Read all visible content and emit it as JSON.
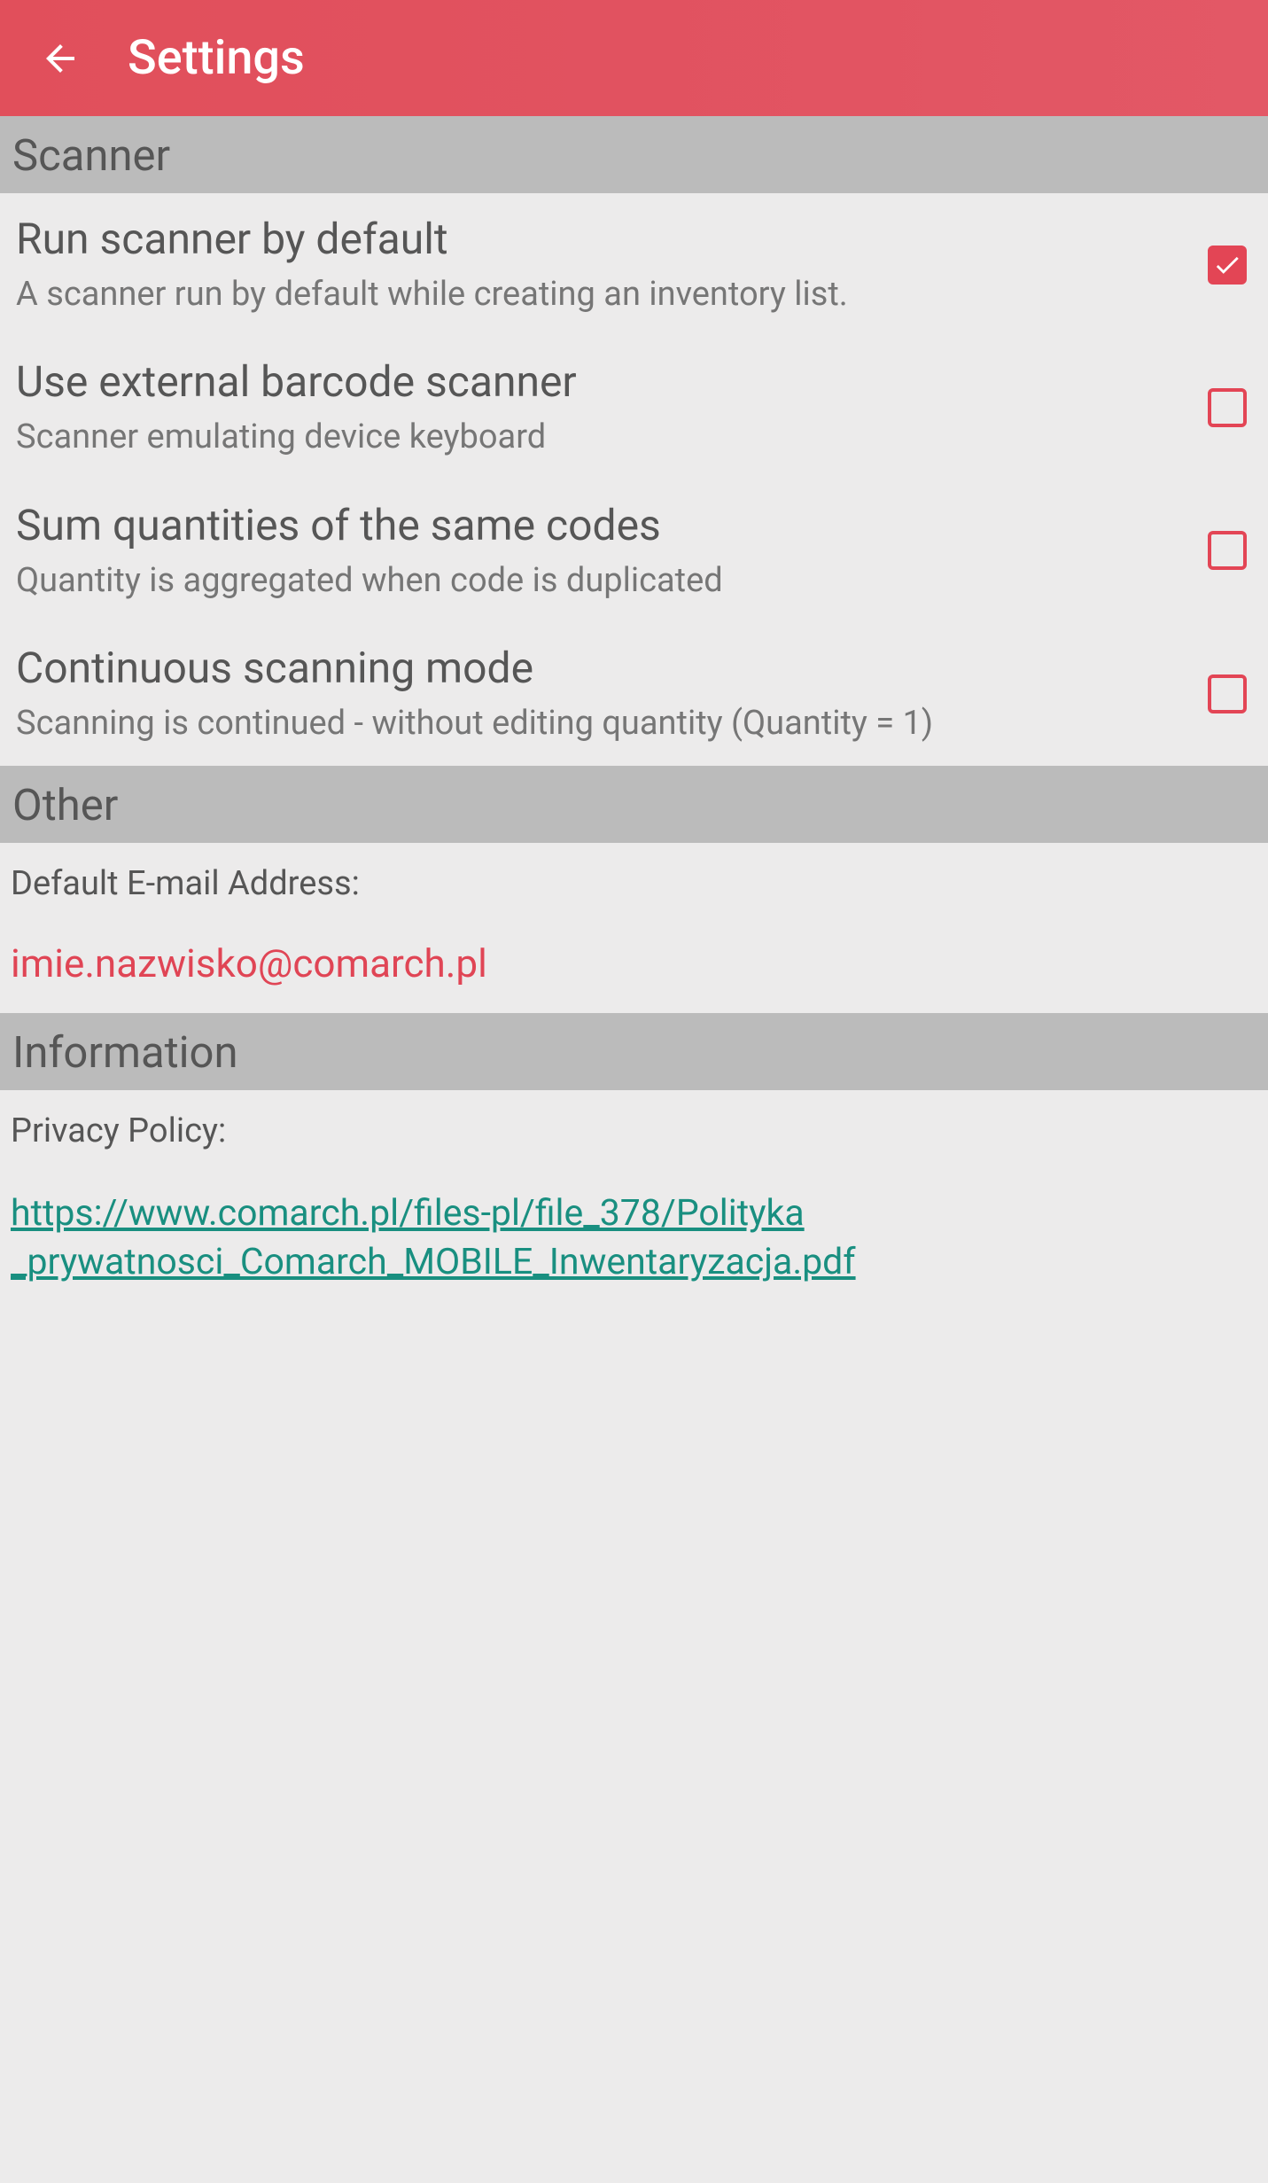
{
  "header": {
    "title": "Settings"
  },
  "sections": {
    "scanner": {
      "header": "Scanner",
      "items": [
        {
          "title": "Run scanner by default",
          "desc": "A scanner run by default while creating an inventory list.",
          "checked": true
        },
        {
          "title": "Use external barcode scanner",
          "desc": "Scanner emulating device keyboard",
          "checked": false
        },
        {
          "title": "Sum quantities of the same codes",
          "desc": "Quantity is aggregated when code is duplicated",
          "checked": false
        },
        {
          "title": "Continuous scanning mode",
          "desc": "Scanning is continued - without editing quantity (Quantity = 1)",
          "checked": false
        }
      ]
    },
    "other": {
      "header": "Other",
      "email_label": "Default E-mail Address:",
      "email_value": "imie.nazwisko@comarch.pl"
    },
    "information": {
      "header": "Information",
      "privacy_label": "Privacy Policy:",
      "privacy_link": "https://www.comarch.pl/files-pl/file_378/Polityka _prywatnosci_Comarch_MOBILE_Inwentaryzacja.pdf"
    }
  }
}
